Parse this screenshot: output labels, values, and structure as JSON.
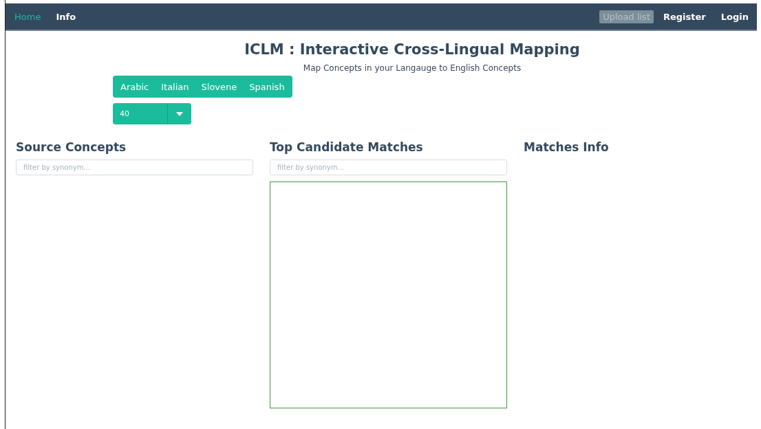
{
  "navbar": {
    "left_links": [
      {
        "label": "Home",
        "selected": true
      },
      {
        "label": "Info",
        "selected": false
      }
    ],
    "upload_button": {
      "label": "Upload list",
      "disabled": true
    },
    "right_links": [
      "Register",
      "Login"
    ]
  },
  "title": "ICLM : Interactive Cross-Lingual Mapping",
  "subtitle": "Map Concepts in your Langauge to English Concepts",
  "languages": [
    "Arabic",
    "Italian",
    "Slovene",
    "Spanish"
  ],
  "count_select": {
    "value": "40"
  },
  "columns": [
    {
      "heading": "Source Concepts",
      "search": {
        "placeholder": "filter by synonym..."
      },
      "kind": "list"
    },
    {
      "heading": "Top Candidate Matches",
      "search": {
        "placeholder": "filter by synonym..."
      },
      "kind": "boxed"
    },
    {
      "heading": "Matches Info",
      "kind": "plain"
    }
  ]
}
